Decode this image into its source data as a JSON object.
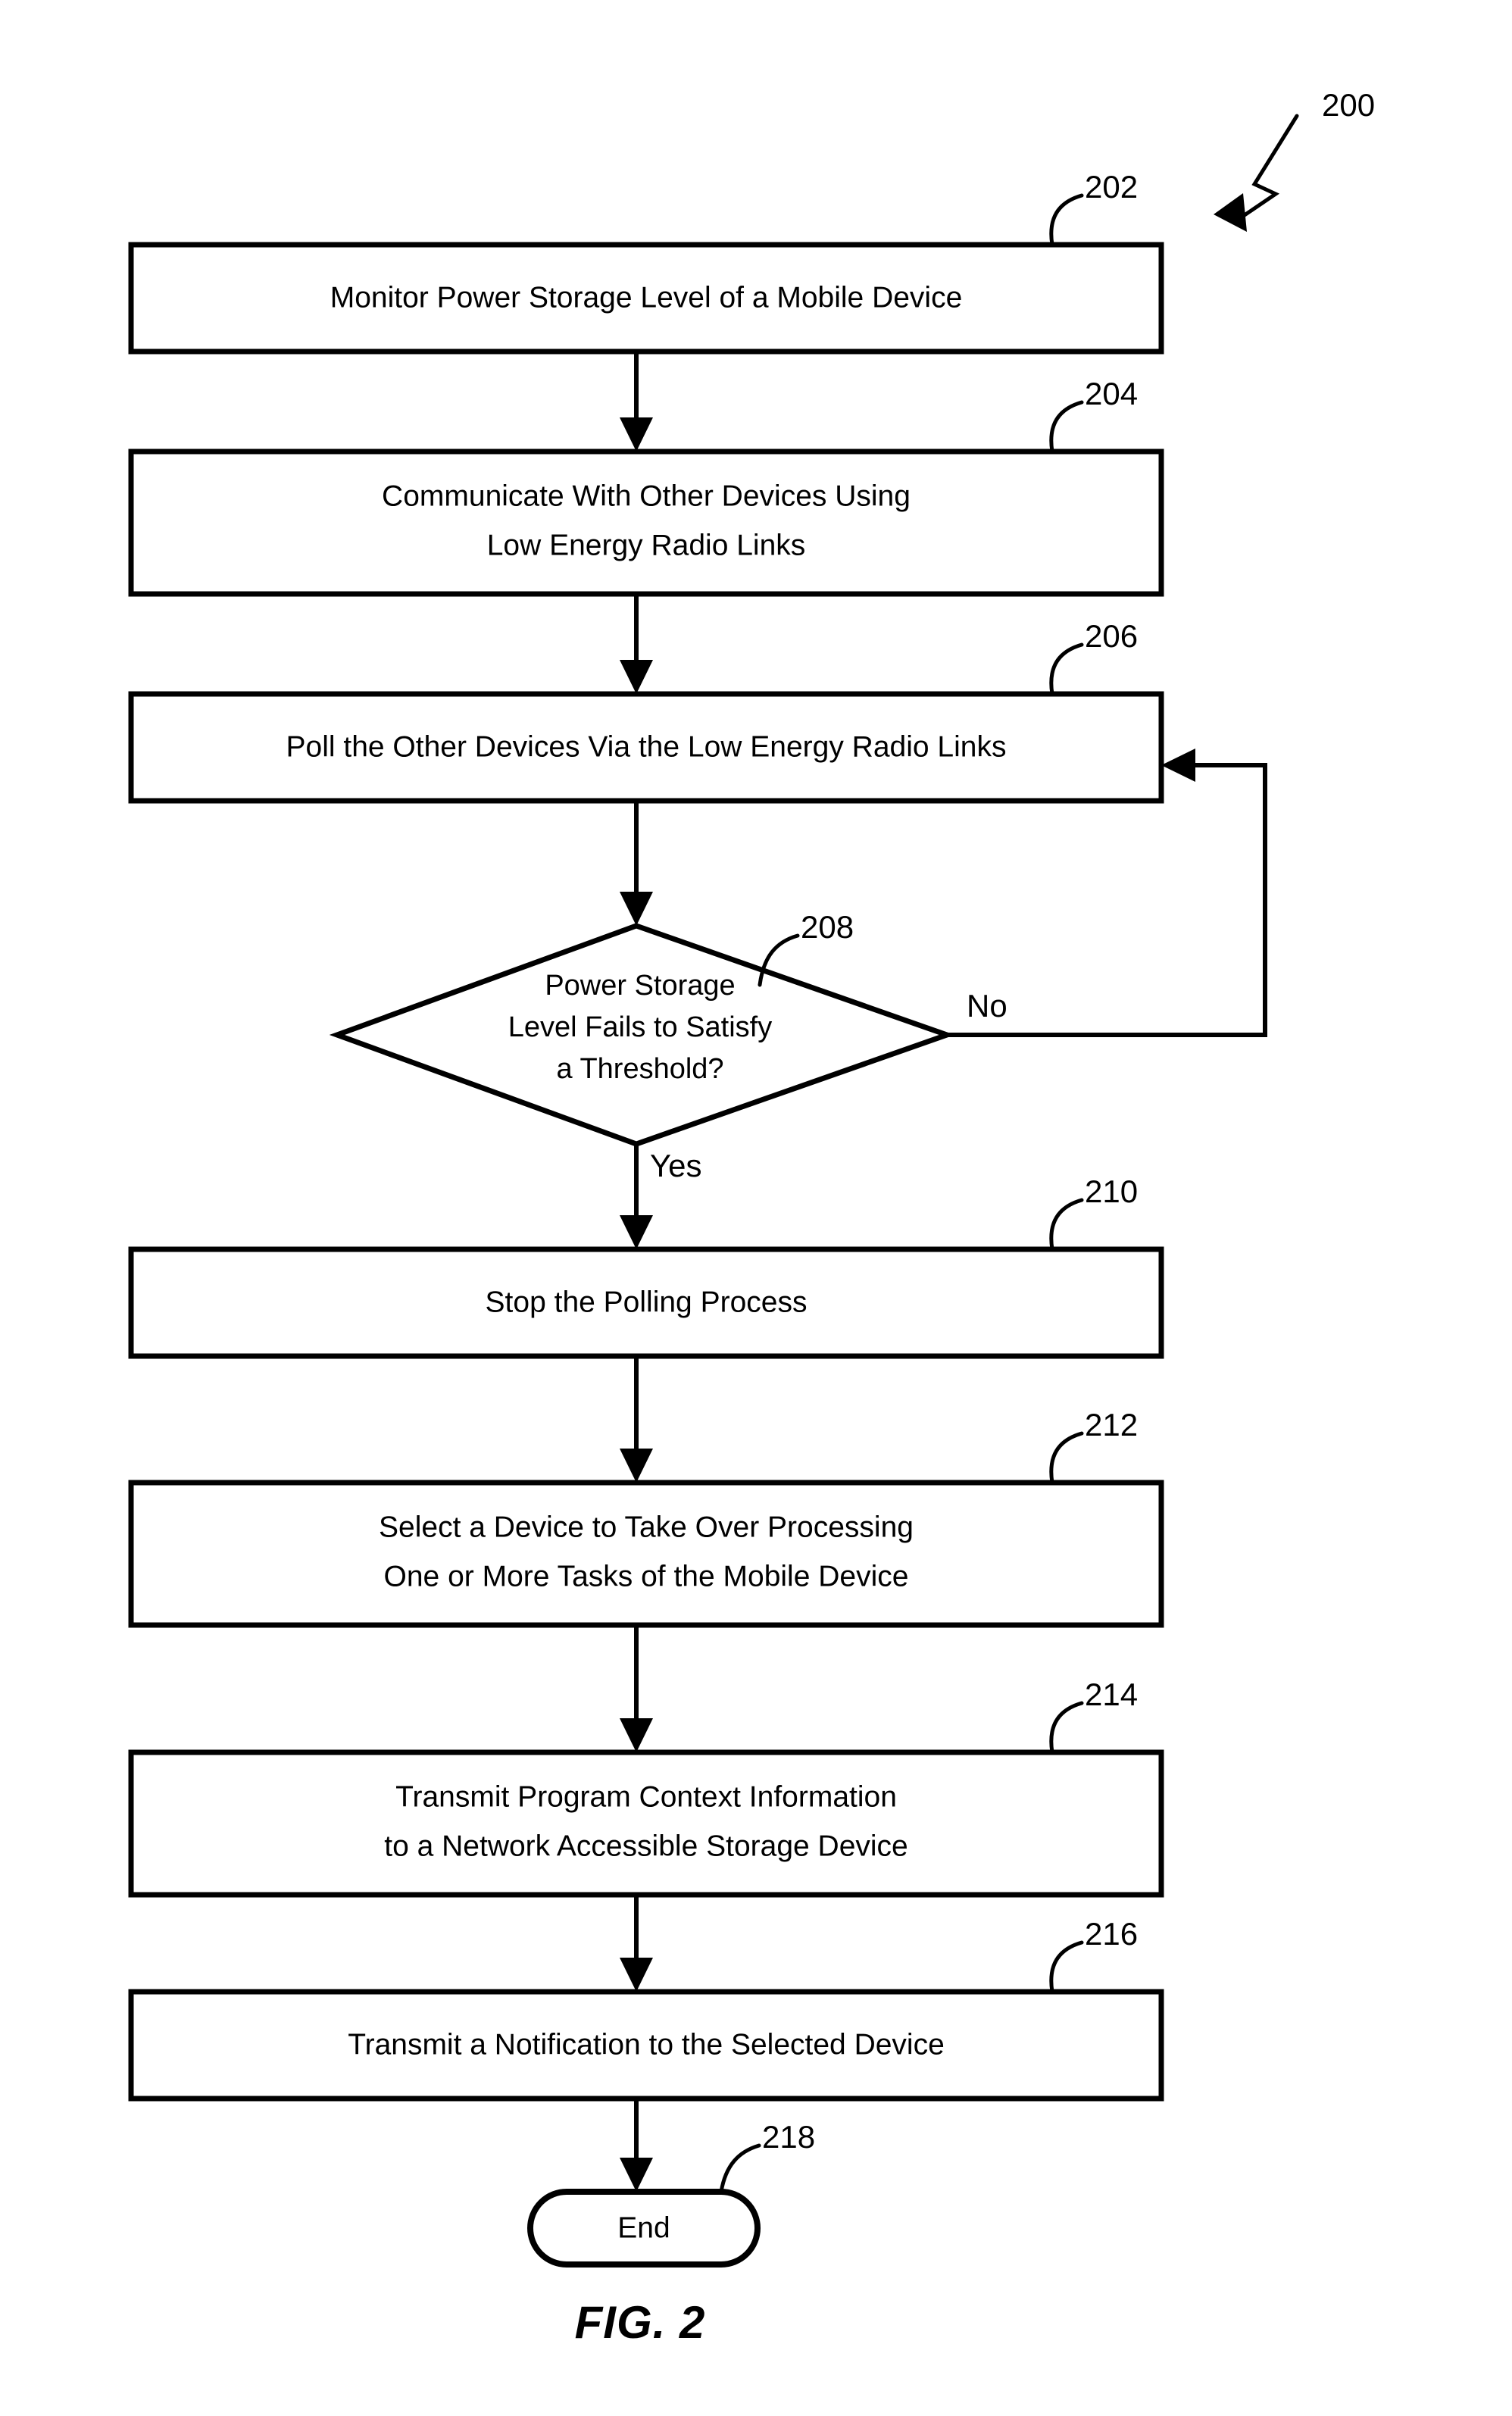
{
  "figure": {
    "caption": "FIG. 2",
    "diagram_ref": "200"
  },
  "chart_data": {
    "type": "diagram",
    "diagram_kind": "flowchart",
    "title": "FIG. 2",
    "reference_numeral": "200",
    "orientation": "top-to-bottom"
  },
  "nodes": {
    "n202": {
      "ref": "202",
      "kind": "process",
      "lines": [
        "Monitor Power Storage Level of a Mobile Device"
      ]
    },
    "n204": {
      "ref": "204",
      "kind": "process",
      "line1": "Communicate With Other Devices Using",
      "line2": "Low Energy Radio Links"
    },
    "n206": {
      "ref": "206",
      "kind": "process",
      "lines": [
        "Poll the Other Devices Via the Low Energy Radio Links"
      ]
    },
    "n208": {
      "ref": "208",
      "kind": "decision",
      "line1": "Power Storage",
      "line2": "Level Fails to Satisfy",
      "line3": "a Threshold?",
      "branch_no": "No",
      "branch_yes": "Yes"
    },
    "n210": {
      "ref": "210",
      "kind": "process",
      "lines": [
        "Stop the Polling Process"
      ]
    },
    "n212": {
      "ref": "212",
      "kind": "process",
      "line1": "Select a Device to Take Over Processing",
      "line2": "One or More Tasks of the Mobile Device"
    },
    "n214": {
      "ref": "214",
      "kind": "process",
      "line1": "Transmit Program Context Information",
      "line2": "to a Network Accessible Storage Device"
    },
    "n216": {
      "ref": "216",
      "kind": "process",
      "lines": [
        "Transmit a Notification to the Selected Device"
      ]
    },
    "n218": {
      "ref": "218",
      "kind": "terminal",
      "label": "End"
    }
  },
  "single_line": {
    "n202": "Monitor Power Storage Level of a Mobile Device",
    "n206": "Poll the Other Devices Via the Low Energy Radio Links",
    "n210": "Stop the Polling Process",
    "n216": "Transmit a Notification to the Selected Device"
  },
  "colors": {
    "stroke": "#000000",
    "fill": "#ffffff",
    "background": "#ffffff"
  }
}
